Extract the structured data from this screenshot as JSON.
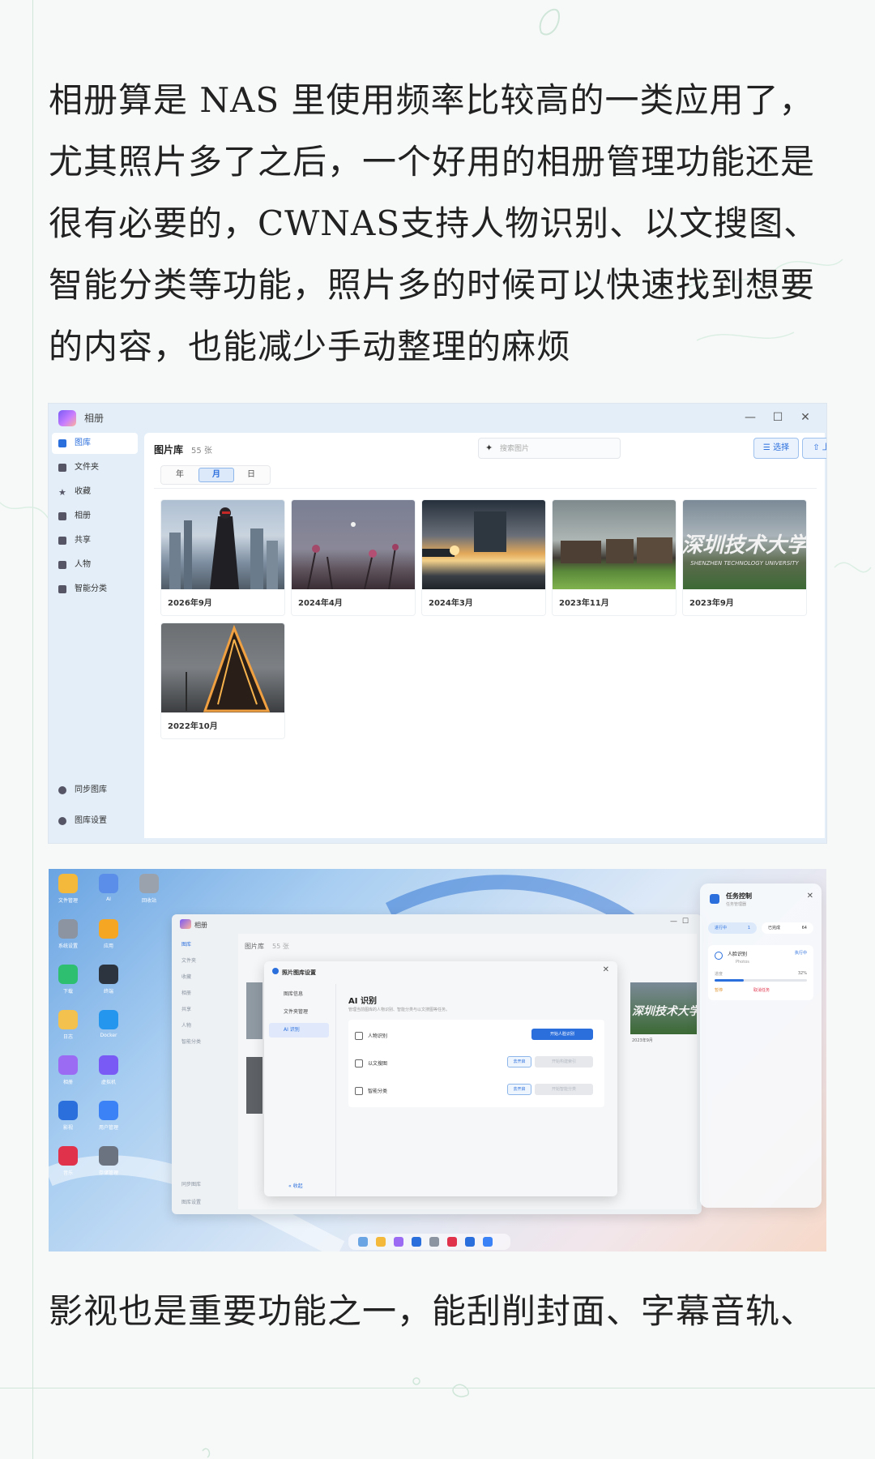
{
  "article": {
    "paragraph1": "相册算是 NAS 里使用频率比较高的一类应用了，尤其照片多了之后，一个好用的相册管理功能还是很有必要的，CWNAS支持人物识别、以文搜图、智能分类等功能，照片多的时候可以快速找到想要的内容，也能减少手动整理的麻烦",
    "paragraph2": "影视也是重要功能之一，能刮削封面、字幕音轨、"
  },
  "photo_app": {
    "window_title": "相册",
    "window_controls": [
      "—",
      "☐",
      "✕"
    ],
    "sidebar": [
      {
        "label": "图库",
        "icon": "gallery-icon",
        "active": true
      },
      {
        "label": "文件夹",
        "icon": "folder-icon"
      },
      {
        "label": "收藏",
        "icon": "star-icon"
      },
      {
        "label": "相册",
        "icon": "album-icon"
      },
      {
        "label": "共享",
        "icon": "share-icon"
      },
      {
        "label": "人物",
        "icon": "people-icon"
      },
      {
        "label": "智能分类",
        "icon": "grid-icon"
      }
    ],
    "sidebar_footer": [
      {
        "label": "同步图库",
        "icon": "sync-icon"
      },
      {
        "label": "图库设置",
        "icon": "settings-icon"
      }
    ],
    "heading": "图片库",
    "count": "55 张",
    "search_placeholder": "搜索图片",
    "select_button": "选择",
    "upload_button": "上传",
    "refresh_icon": "refresh-icon",
    "tabs": [
      {
        "label": "年"
      },
      {
        "label": "月",
        "active": true
      },
      {
        "label": "日"
      }
    ],
    "albums": [
      {
        "label": "2026年9月"
      },
      {
        "label": "2024年4月"
      },
      {
        "label": "2024年3月"
      },
      {
        "label": "2023年11月"
      },
      {
        "label": "2023年9月",
        "overlay": "深圳技术大学",
        "overlay_sub": "SHENZHEN TECHNOLOGY UNIVERSITY"
      },
      {
        "label": "2022年10月"
      }
    ]
  },
  "desktop": {
    "desk_icons": [
      {
        "label": "文件管理",
        "color": "#f4b93b"
      },
      {
        "label": "AI",
        "color": "#5a8ee8"
      },
      {
        "label": "回收站",
        "color": "#9aa3ad"
      },
      {
        "label": "系统设置",
        "color": "#8b94a0"
      },
      {
        "label": "应用",
        "color": "#f5a623"
      },
      {
        "label": "下载",
        "color": "#2fbf71"
      },
      {
        "label": "终端",
        "color": "#2c3440"
      },
      {
        "label": "日志",
        "color": "#f2c14e"
      },
      {
        "label": "Docker",
        "color": "#2496ed"
      },
      {
        "label": "相册",
        "color": "#9b6bf3"
      },
      {
        "label": "虚拟机",
        "color": "#7a5af5"
      },
      {
        "label": "影视",
        "color": "#2b6fdd"
      },
      {
        "label": "用户管理",
        "color": "#3b82f6"
      },
      {
        "label": "音乐",
        "color": "#e0334b"
      },
      {
        "label": "存储管理",
        "color": "#6b7280"
      }
    ],
    "window_title": "相册",
    "window_heading": "图片库",
    "window_count": "55 张",
    "window_sidebar": [
      "图库",
      "文件夹",
      "收藏",
      "相册",
      "共享",
      "人物",
      "智能分类"
    ],
    "window_sidebar_footer": [
      "同步图库",
      "图库设置"
    ],
    "window_albums": [
      "2023年9月"
    ],
    "dialog": {
      "title": "照片图库设置",
      "nav": [
        {
          "label": "图库信息"
        },
        {
          "label": "文件夹管理"
        },
        {
          "label": "AI 识别",
          "active": true
        }
      ],
      "heading": "AI 识别",
      "subtitle": "管理当前图库的人物识别、智能分类与以文搜图等任务。",
      "rows": [
        {
          "label": "人物识别",
          "button": "开始人脸识别",
          "button_style": "primary"
        },
        {
          "label": "以文搜图",
          "button": "去开启",
          "button2": "开始构建索引"
        },
        {
          "label": "智能分类",
          "button": "去开启",
          "button2": "开始智能分类"
        }
      ],
      "collapse_label": "« 收起"
    },
    "task_panel": {
      "title": "任务控制",
      "subtitle": "任务管理器",
      "pills": [
        {
          "label": "进行中",
          "count": "1"
        },
        {
          "label": "已完成",
          "count": "64"
        }
      ],
      "task_name": "人脸识别",
      "task_status": "执行中",
      "task_folder": "Photos",
      "progress_label": "进度",
      "progress_pct": "32%",
      "progress_fraction": 0.32,
      "pause_label": "暂停",
      "cancel_label": "取消任务"
    },
    "dock_colors": [
      "#6aa4e2",
      "#f4b93b",
      "#9b6bf3",
      "#2b6fdd",
      "#8b94a0",
      "#e0334b",
      "#2b6fdd",
      "#3b82f6"
    ]
  },
  "colors": {
    "accent": "#2b6fdd",
    "deco_green": "#cfe6d9"
  }
}
